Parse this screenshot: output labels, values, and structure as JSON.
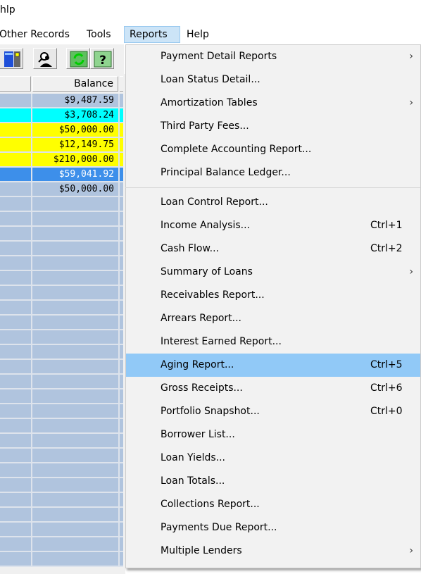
{
  "title_fragment": "hlp",
  "menubar": {
    "items": [
      {
        "label": "Other Records",
        "active": false
      },
      {
        "label": "Tools",
        "active": false
      },
      {
        "label": "Reports",
        "active": true
      },
      {
        "label": "Help",
        "active": false
      }
    ]
  },
  "toolbar": {
    "buttons": [
      {
        "icon": "calculator-icon"
      },
      {
        "icon": "search-person-icon"
      },
      {
        "icon": "refresh-icon"
      },
      {
        "icon": "help-icon"
      }
    ]
  },
  "grid": {
    "column_header": "Balance",
    "rows": [
      {
        "balance": "$9,487.59",
        "style": "plain"
      },
      {
        "balance": "$3,708.24",
        "style": "cyan"
      },
      {
        "balance": "$50,000.00",
        "style": "yellow"
      },
      {
        "balance": "$12,149.75",
        "style": "yellow"
      },
      {
        "balance": "$210,000.00",
        "style": "yellow"
      },
      {
        "balance": "$59,041.92",
        "style": "selected"
      },
      {
        "balance": "$50,000.00",
        "style": "plain"
      }
    ],
    "empty_rows": 25,
    "colors": {
      "plain": "#b0c4de",
      "cyan": "#00ffff",
      "yellow": "#ffff00",
      "selected": "#3d8fea"
    }
  },
  "reports_menu": {
    "groups": [
      [
        {
          "label": "Payment Detail Reports",
          "shortcut": "",
          "submenu": true
        },
        {
          "label": "Loan Status Detail...",
          "shortcut": "",
          "submenu": false
        },
        {
          "label": "Amortization Tables",
          "shortcut": "",
          "submenu": true
        },
        {
          "label": "Third Party Fees...",
          "shortcut": "",
          "submenu": false
        },
        {
          "label": "Complete Accounting Report...",
          "shortcut": "",
          "submenu": false
        },
        {
          "label": "Principal Balance Ledger...",
          "shortcut": "",
          "submenu": false
        }
      ],
      [
        {
          "label": "Loan Control Report...",
          "shortcut": "",
          "submenu": false
        },
        {
          "label": "Income Analysis...",
          "shortcut": "Ctrl+1",
          "submenu": false
        },
        {
          "label": "Cash Flow...",
          "shortcut": "Ctrl+2",
          "submenu": false
        },
        {
          "label": "Summary of Loans",
          "shortcut": "",
          "submenu": true
        },
        {
          "label": "Receivables Report...",
          "shortcut": "",
          "submenu": false
        },
        {
          "label": "Arrears Report...",
          "shortcut": "",
          "submenu": false
        },
        {
          "label": "Interest Earned Report...",
          "shortcut": "",
          "submenu": false
        },
        {
          "label": "Aging Report...",
          "shortcut": "Ctrl+5",
          "submenu": false,
          "highlighted": true
        },
        {
          "label": "Gross Receipts...",
          "shortcut": "Ctrl+6",
          "submenu": false
        },
        {
          "label": "Portfolio Snapshot...",
          "shortcut": "Ctrl+0",
          "submenu": false
        },
        {
          "label": "Borrower List...",
          "shortcut": "",
          "submenu": false
        },
        {
          "label": "Loan Yields...",
          "shortcut": "",
          "submenu": false
        },
        {
          "label": "Loan Totals...",
          "shortcut": "",
          "submenu": false
        },
        {
          "label": "Collections Report...",
          "shortcut": "",
          "submenu": false
        },
        {
          "label": "Payments Due Report...",
          "shortcut": "",
          "submenu": false
        },
        {
          "label": "Multiple Lenders",
          "shortcut": "",
          "submenu": true
        }
      ]
    ],
    "submenu_arrow": "›",
    "highlight_color": "#91c9f7"
  }
}
